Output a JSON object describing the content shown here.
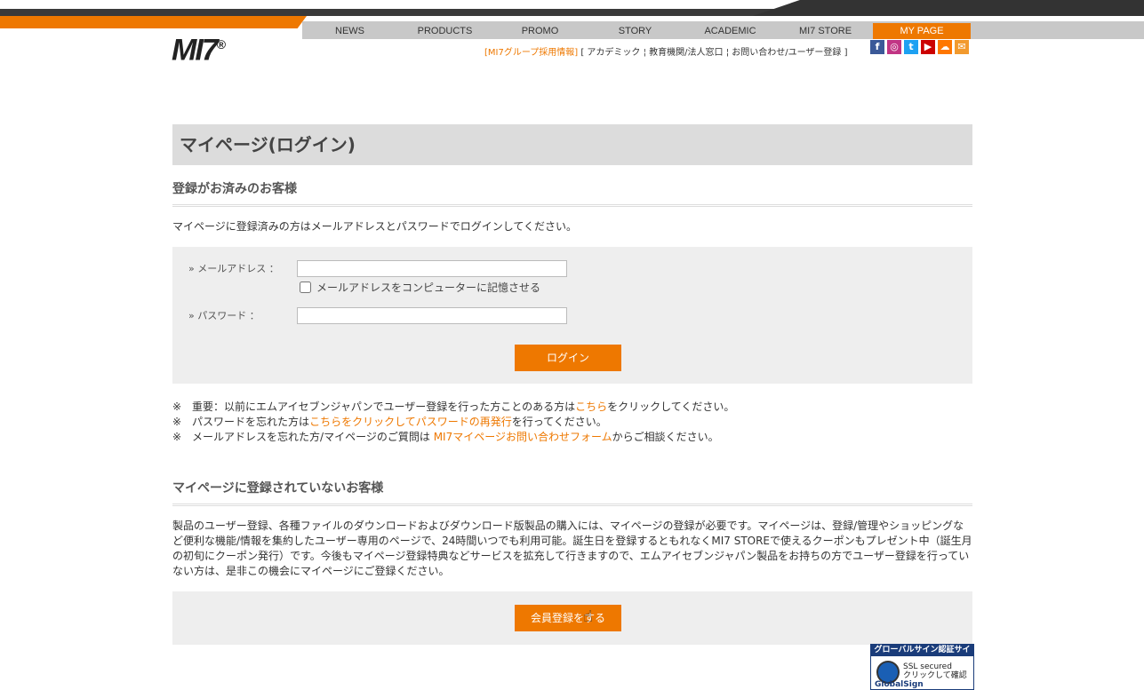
{
  "header": {
    "logo": "MI7",
    "logo_mark": "®",
    "nav": [
      "NEWS",
      "PRODUCTS",
      "PROMO",
      "STORY",
      "ACADEMIC",
      "MI7 STORE",
      "MY PAGE"
    ],
    "sublinks": {
      "recruit": "[MI7グループ採用情報]",
      "rest": " [ アカデミック ¦ 教育機関/法人窓口 ¦ お問い合わせ/ユーザー登録 ]"
    },
    "social_icons": [
      "facebook-icon",
      "instagram-icon",
      "twitter-icon",
      "youtube-icon",
      "soundcloud-icon",
      "mail-icon"
    ],
    "colors": {
      "accent": "#ee7800",
      "nav_bg": "#c8c8c8"
    }
  },
  "page": {
    "title": "マイページ(ログイン)",
    "registered_heading": "登録がお済みのお客様",
    "registered_intro": "マイページに登録済みの方はメールアドレスとパスワードでログインしてください。",
    "email_label": "» メールアドレス ：",
    "email_value": "",
    "remember_label": "メールアドレスをコンピューターに記憶させる",
    "password_label": "» パスワード ：",
    "password_value": "",
    "login_button": "ログイン",
    "notes": [
      {
        "pre": "※　重要：以前にエムアイセブンジャパンでユーザー登録を行った方ことのある方は",
        "link": "こちら",
        "post": "をクリックしてください。"
      },
      {
        "pre": "※　パスワードを忘れた方は",
        "link": "こちらをクリックしてパスワードの再発行",
        "post": "を行ってください。"
      },
      {
        "pre": "※　メールアドレスを忘れた方/マイページのご質問は ",
        "link": "MI7マイページお問い合わせフォーム",
        "post": "からご相談ください。"
      }
    ],
    "unregistered_heading": "マイページに登録されていないお客様",
    "unregistered_desc": "製品のユーザー登録、各種ファイルのダウンロードおよびダウンロード版製品の購入には、マイページの登録が必要です。マイページは、登録/管理やショッピングなど便利な機能/情報を集約したユーザー専用のページで、24時間いつでも利用可能。誕生日を登録するともれなくMI7 STOREで使えるクーポンもプレゼント中（誕生月の初旬にクーポン発行）です。今後もマイページ登録特典などサービスを拡充して行きますので、エムアイセブンジャパン製品をお持ちの方でユーザー登録を行っていない方は、是非この機会にマイページにご登録ください。",
    "register_button": "会員登録をする"
  },
  "seal": {
    "title": "グローバルサイン認証サイト",
    "ssl": "SSL secured",
    "click": "クリックして確認",
    "brand": "GlobalSign"
  }
}
